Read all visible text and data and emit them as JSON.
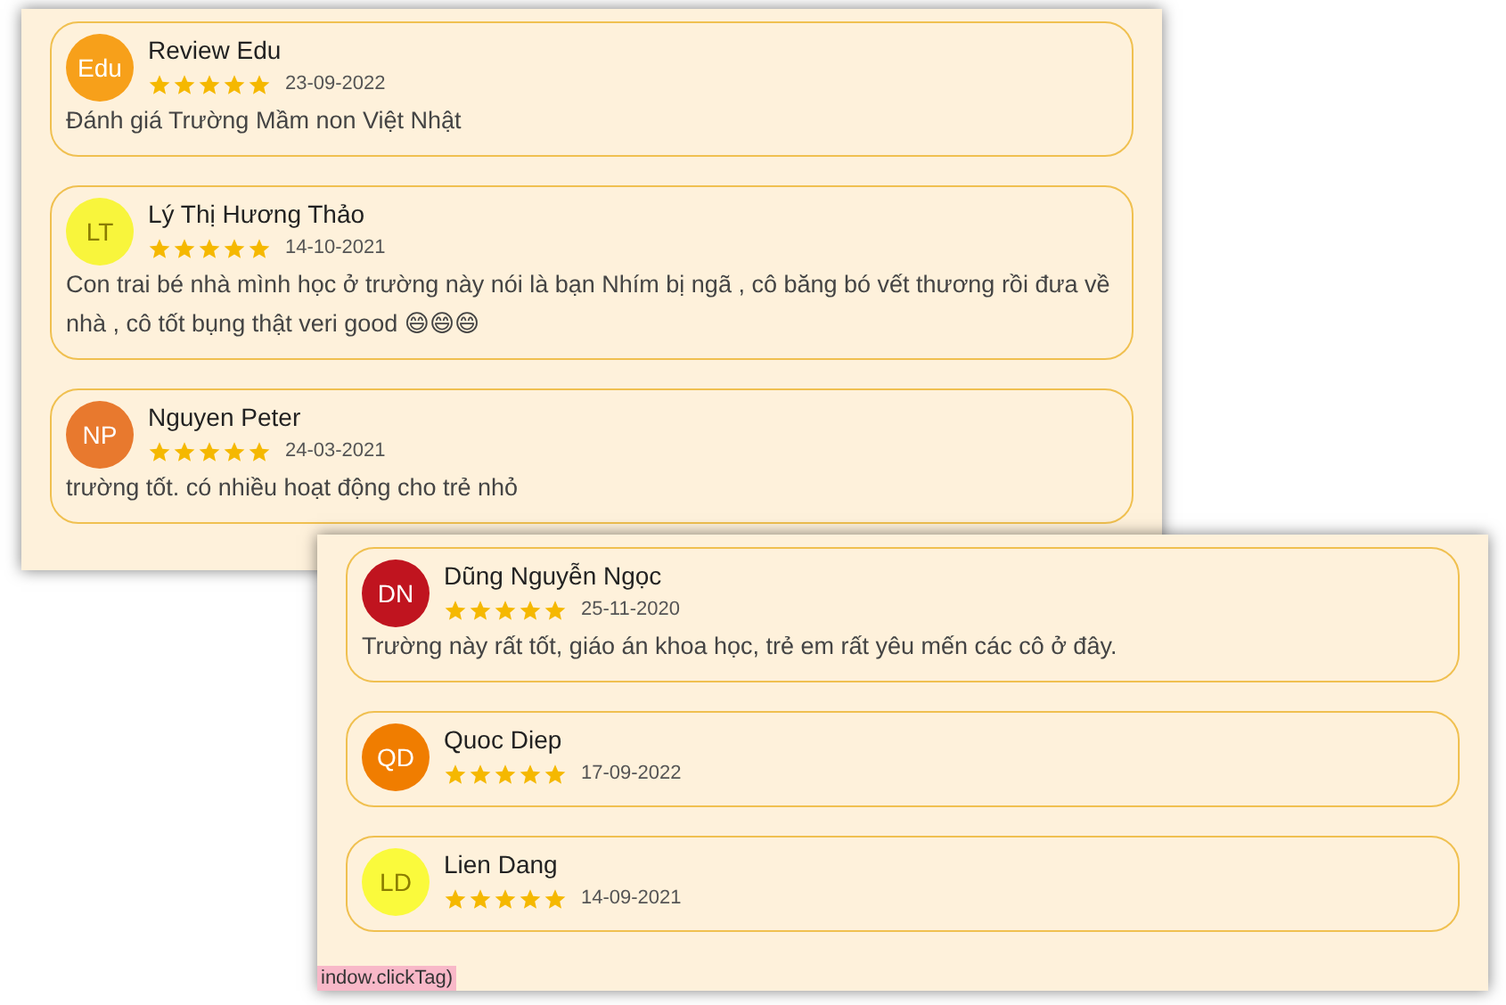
{
  "panels": [
    {
      "reviews": [
        {
          "initials": "Edu",
          "color": "#f7a01a",
          "name": "Review Edu",
          "stars": 5,
          "date": "23-09-2022",
          "comment": "Đánh giá Trường Mầm non Việt Nhật"
        },
        {
          "initials": "LT",
          "color": "#f8f53c",
          "name": "Lý Thị Hương Thảo",
          "stars": 5,
          "date": "14-10-2021",
          "comment": "Con trai bé nhà mình học ở trường này nói là bạn Nhím bị ngã , cô băng bó vết thương rồi đưa về nhà , cô tốt bụng thật veri good 😄😄😄"
        },
        {
          "initials": "NP",
          "color": "#e8792e",
          "name": "Nguyen Peter",
          "stars": 5,
          "date": "24-03-2021",
          "comment": "trường tốt. có nhiều hoạt động cho trẻ nhỏ"
        }
      ]
    },
    {
      "reviews": [
        {
          "initials": "DN",
          "color": "#c0141f",
          "name": "Dũng Nguyễn Ngọc",
          "stars": 5,
          "date": "25-11-2020",
          "comment": "Trường này rất tốt, giáo án khoa học, trẻ em rất yêu mến các cô ở đây."
        },
        {
          "initials": "QD",
          "color": "#f07d00",
          "name": "Quoc Diep",
          "stars": 5,
          "date": "17-09-2022"
        },
        {
          "initials": "LD",
          "color": "#fafa3c",
          "name": "Lien Dang",
          "stars": 5,
          "date": "14-09-2021"
        }
      ],
      "tag": "indow.clickTag)"
    }
  ]
}
